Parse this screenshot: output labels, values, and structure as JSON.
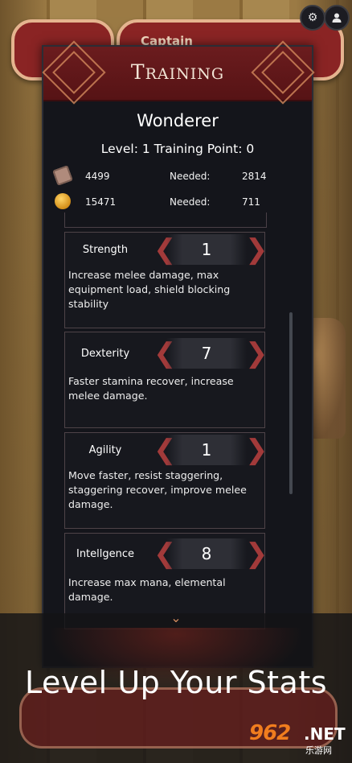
{
  "header": {
    "tab_label": "Captain",
    "window_title_cap": "T",
    "window_title_rest": "RAINING",
    "settings_icon": "gear-icon",
    "profile_icon": "person-icon"
  },
  "character": {
    "name": "Wonderer",
    "level_line": "Level: 1 Training Point: 0"
  },
  "resources": [
    {
      "icon": "book-icon",
      "amount": "4499",
      "needed_label": "Needed:",
      "needed": "2814"
    },
    {
      "icon": "coin-icon",
      "amount": "15471",
      "needed_label": "Needed:",
      "needed": "711"
    }
  ],
  "stats": [
    {
      "name": "Strength",
      "value": "1",
      "desc": "Increase melee damage, max equipment load, shield blocking stability"
    },
    {
      "name": "Dexterity",
      "value": "7",
      "desc": "Faster stamina recover,  increase melee damage."
    },
    {
      "name": "Agility",
      "value": "1",
      "desc": "Move faster,  resist staggering, staggering recover, improve melee damage."
    },
    {
      "name": "Intellgence",
      "value": "8",
      "desc": "Increase max mana, elemental damage."
    }
  ],
  "banner": {
    "text": "Level Up Your Stats"
  },
  "watermark": {
    "num": "962",
    "net": ".NET",
    "cn": "乐游网"
  },
  "colors": {
    "header_red": "#6b1c1e",
    "arrow_red": "#a23a3a",
    "panel_bg": "#14151b"
  }
}
